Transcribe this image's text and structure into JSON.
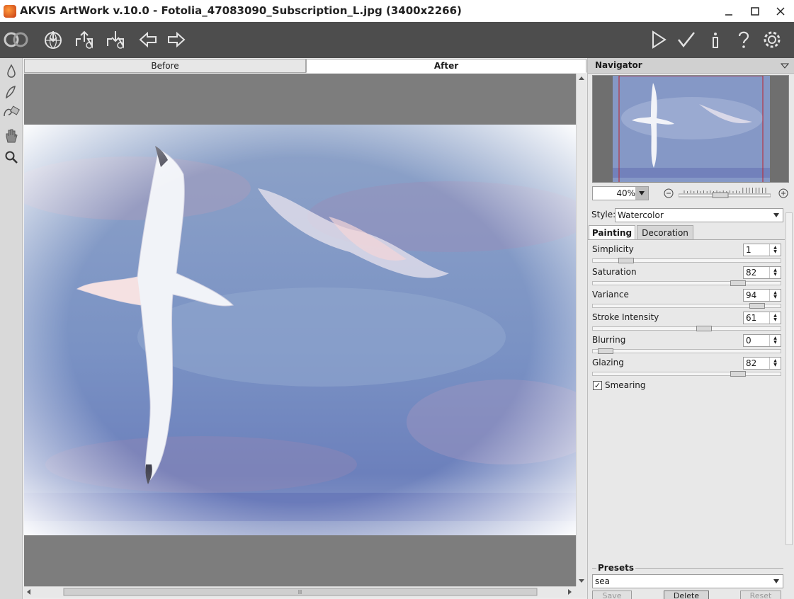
{
  "window": {
    "title": "AKVIS ArtWork v.10.0 - Fotolia_47083090_Subscription_L.jpg (3400x2266)"
  },
  "view_tabs": {
    "before": "Before",
    "after": "After"
  },
  "navigator": {
    "title": "Navigator",
    "zoom": "40%",
    "zoom_level": 0.4
  },
  "style": {
    "label": "Style:",
    "value": "Watercolor"
  },
  "param_tabs": {
    "painting": "Painting",
    "decoration": "Decoration"
  },
  "params": [
    {
      "label": "Simplicity",
      "value": "1",
      "level": 0.15
    },
    {
      "label": "Saturation",
      "value": "82",
      "level": 0.8
    },
    {
      "label": "Variance",
      "value": "94",
      "level": 0.91
    },
    {
      "label": "Stroke Intensity",
      "value": "61",
      "level": 0.6
    },
    {
      "label": "Blurring",
      "value": "0",
      "level": 0.03
    },
    {
      "label": "Glazing",
      "value": "82",
      "level": 0.8
    }
  ],
  "smearing": {
    "label": "Smearing",
    "checked": true,
    "mark": "✓"
  },
  "presets": {
    "title": "Presets",
    "value": "sea",
    "save": "Save",
    "delete": "Delete",
    "reset": "Reset"
  },
  "icons": {
    "toolbar_left": [
      "logo-icon",
      "open-icon",
      "save-icon",
      "print-icon",
      "undo-icon",
      "redo-icon"
    ],
    "toolbar_right": [
      "run-icon",
      "apply-icon",
      "info-icon",
      "help-icon",
      "settings-icon"
    ],
    "tools": [
      "drop-icon",
      "brush-icon",
      "eraser-icon",
      "hand-icon",
      "zoom-icon"
    ]
  }
}
